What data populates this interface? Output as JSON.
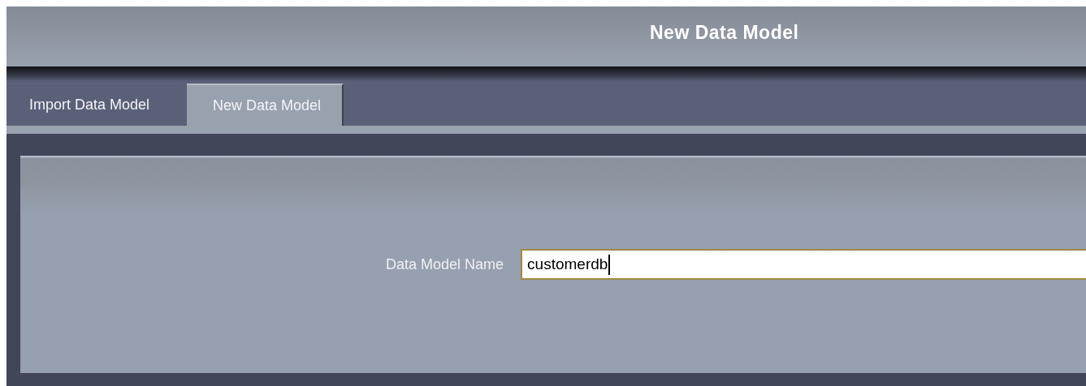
{
  "window": {
    "title": "New Data Model"
  },
  "tabs": [
    {
      "label": "Import Data Model",
      "selected": false
    },
    {
      "label": "New Data Model",
      "selected": true
    }
  ],
  "form": {
    "label": "Data Model Name",
    "value": "customerdb",
    "focused": true
  }
}
